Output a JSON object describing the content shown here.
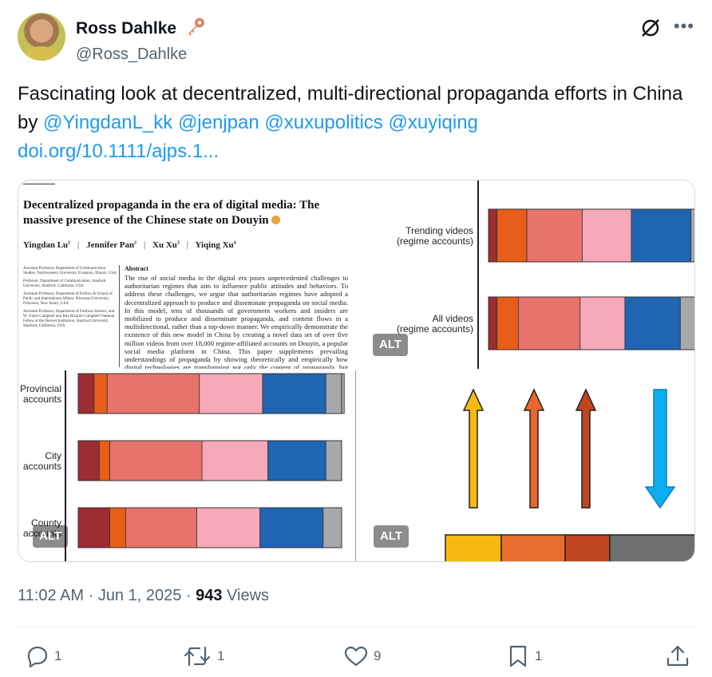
{
  "author": {
    "display_name": "Ross Dahlke",
    "handle": "@Ross_Dahlke"
  },
  "tweet": {
    "text_before": "Fascinating look at decentralized, multi-directional propaganda efforts in China by ",
    "mentions": [
      "@YingdanL_kk",
      "@jenjpan",
      "@xuxupolitics",
      "@xuyiqing"
    ],
    "link": "doi.org/10.1111/ajps.1..."
  },
  "media": {
    "alt_label": "ALT",
    "paper": {
      "title": "Decentralized propaganda in the era of digital media: The massive presence of the Chinese state on Douyin",
      "authors": [
        "Yingdan Lu",
        "Jennifer Pan",
        "Xu Xu",
        "Yiqing Xu"
      ],
      "affiliations": [
        "Assistant Professor, Department of Communication Studies, Northwestern University, Evanston, Illinois, USA",
        "Professor, Department of Communication, Stanford University, Stanford, California, USA",
        "Assistant Professor, Department of Politics & School of Public and International Affairs, Princeton University, Princeton, New Jersey, USA",
        "Assistant Professor, Department of Political Science, and W. Glenn Campbell and Rita Ricardo-Campbell National Fellow at the Hoover Institution, Stanford University, Stanford, California, USA"
      ],
      "abstract_heading": "Abstract",
      "abstract": "The rise of social media in the digital era poses unprecedented challenges to authoritarian regimes that aim to influence public attitudes and behaviors. To address these challenges, we argue that authoritarian regimes have adopted a decentralized approach to produce and disseminate propaganda on social media. In this model, tens of thousands of government workers and insiders are mobilized to produce and disseminate propaganda, and content flows in a multidirectional, rather than a top-down manner. We empirically demonstrate the existence of this new model in China by creating a novel data set of over five million videos from over 18,000 regime-affiliated accounts on Douyin, a popular social media platform in China. This paper supplements prevailing understandings of propaganda by showing theoretically and empirically how digital technologies are transforming not only the content of propaganda, but also how propaganda materials are produced and"
    },
    "colors": [
      "#9b2d33",
      "#e85d17",
      "#e8736d",
      "#f6a9b8",
      "#1f65b2",
      "#a6a9ac"
    ],
    "arrow_colors": [
      "#f7b90f",
      "#e8672a",
      "#c0461f",
      "#0aaeee"
    ]
  },
  "chart_data": [
    {
      "type": "bar",
      "orientation": "horizontal-stacked",
      "categories": [
        "Trending videos\n(regime accounts)",
        "All videos\n(regime accounts)"
      ],
      "series": [
        {
          "values": [
            0.04,
            0.04
          ]
        },
        {
          "values": [
            0.14,
            0.1
          ]
        },
        {
          "values": [
            0.26,
            0.29
          ]
        },
        {
          "values": [
            0.23,
            0.21
          ]
        },
        {
          "values": [
            0.28,
            0.26
          ]
        },
        {
          "values": [
            0.05,
            0.07
          ]
        }
      ]
    },
    {
      "type": "bar",
      "orientation": "horizontal-stacked",
      "categories": [
        "Provincial\naccounts",
        "City\naccounts",
        "County\naccounts"
      ],
      "series": [
        {
          "values": [
            0.06,
            0.08,
            0.12
          ]
        },
        {
          "values": [
            0.05,
            0.04,
            0.06
          ]
        },
        {
          "values": [
            0.35,
            0.35,
            0.27
          ]
        },
        {
          "values": [
            0.24,
            0.25,
            0.24
          ]
        },
        {
          "values": [
            0.24,
            0.22,
            0.24
          ]
        },
        {
          "values": [
            0.07,
            0.06,
            0.07
          ]
        }
      ]
    }
  ],
  "timestamp": {
    "time": "11:02 AM",
    "sep": " · ",
    "date": "Jun 1, 2025",
    "views_count": "943",
    "views_label": " Views"
  },
  "actions": {
    "replies": "1",
    "reposts": "1",
    "likes": "9",
    "bookmarks": "1"
  }
}
